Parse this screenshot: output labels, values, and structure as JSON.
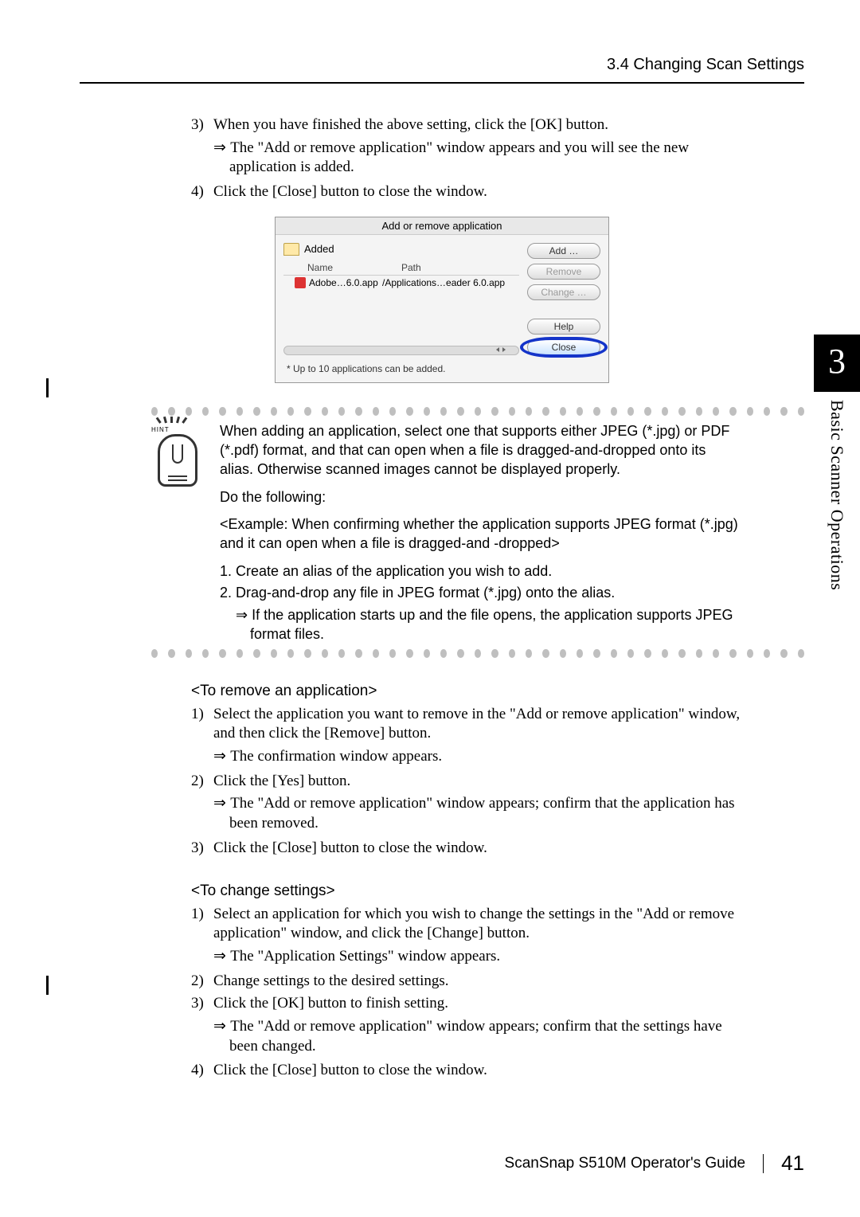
{
  "header": {
    "section": "3.4 Changing Scan Settings"
  },
  "chapter": {
    "num": "3",
    "title": "Basic Scanner Operations"
  },
  "top_steps": {
    "s3_num": "3)",
    "s3_text": "When you have finished the above setting, click the [OK] button.",
    "s3_res": "The \"Add or remove application\" window appears and you will see the new application is added.",
    "s4_num": "4)",
    "s4_text": "Click the [Close] button to close the window."
  },
  "dialog": {
    "title": "Add or remove application",
    "group": "Added",
    "col_name": "Name",
    "col_path": "Path",
    "row_name": "Adobe…6.0.app",
    "row_path": "/Applications…eader 6.0.app",
    "btn_add": "Add …",
    "btn_remove": "Remove",
    "btn_change": "Change …",
    "btn_help": "Help",
    "btn_close": "Close",
    "note": "* Up to 10 applications can be added."
  },
  "hint": {
    "label": "HINT",
    "p1": "When adding an application, select one that supports either JPEG (*.jpg) or PDF (*.pdf) format, and that can open when a file is dragged-and-dropped onto its alias. Otherwise scanned images cannot be displayed properly.",
    "p2": "Do the following:",
    "p3": "<Example: When confirming whether the application supports JPEG format (*.jpg) and it can open when a file is dragged-and -dropped>",
    "li1": "Create an alias of the application you wish to add.",
    "li2": "Drag-and-drop any file in JPEG format (*.jpg) onto the alias.",
    "res": "If the application starts up and the file opens, the application supports JPEG format files."
  },
  "remove": {
    "heading": "<To remove an application>",
    "s1_num": "1)",
    "s1_text": "Select the application you want to remove in the \"Add or remove application\" window, and then click the [Remove] button.",
    "s1_res": "The confirmation window appears.",
    "s2_num": "2)",
    "s2_text": "Click the [Yes] button.",
    "s2_res": "The \"Add or remove application\" window appears; confirm that the application has been removed.",
    "s3_num": "3)",
    "s3_text": "Click the [Close] button to close the window."
  },
  "change": {
    "heading": "<To change settings>",
    "s1_num": "1)",
    "s1_text": "Select an application for which you wish to change the settings in the \"Add or remove application\" window, and click the [Change] button.",
    "s1_res": "The \"Application Settings\" window appears.",
    "s2_num": "2)",
    "s2_text": "Change settings to the desired settings.",
    "s3_num": "3)",
    "s3_text": "Click the [OK] button to finish setting.",
    "s3_res": "The \"Add or remove application\" window appears; confirm that the settings have been changed.",
    "s4_num": "4)",
    "s4_text": "Click the [Close] button to close the window."
  },
  "footer": {
    "guide": "ScanSnap  S510M Operator's Guide",
    "page": "41"
  }
}
